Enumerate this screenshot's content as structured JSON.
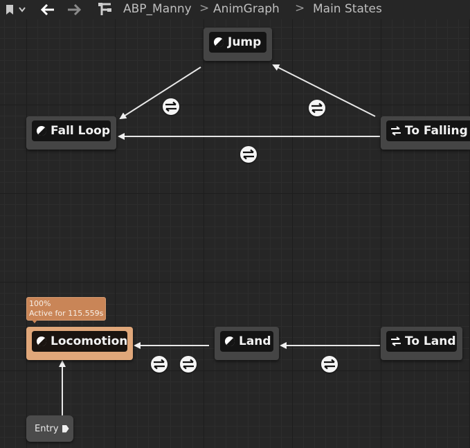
{
  "toolbar": {
    "breadcrumb": [
      "ABP_Manny",
      "AnimGraph",
      "Main States"
    ],
    "separators": [
      ">",
      ">"
    ],
    "icons": [
      "bookmark-icon",
      "chevron-down-icon",
      "back-arrow-icon",
      "forward-arrow-icon",
      "hierarchy-icon"
    ]
  },
  "nodes": {
    "jump": {
      "label": "Jump",
      "icon": "state-icon"
    },
    "fall_loop": {
      "label": "Fall Loop",
      "icon": "state-icon"
    },
    "to_falling": {
      "label": "To Falling",
      "icon": "conduit-icon"
    },
    "locomotion": {
      "label": "Locomotion",
      "icon": "state-icon"
    },
    "land": {
      "label": "Land",
      "icon": "state-icon"
    },
    "to_land": {
      "label": "To Land",
      "icon": "conduit-icon"
    },
    "entry": {
      "label": "Entry",
      "icon": "entry-arrow-icon"
    }
  },
  "active_tooltip": {
    "weight": "100%",
    "active_time": "Active for 115.559s"
  },
  "colors": {
    "background": "#262626",
    "node": "#454545",
    "active_node": "#e0a77a",
    "tooltip": "#c98557",
    "link": "#f0f0f0"
  }
}
